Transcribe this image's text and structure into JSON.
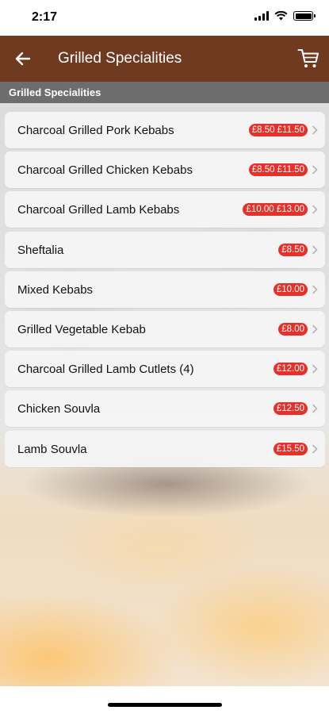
{
  "status": {
    "time": "2:17"
  },
  "header": {
    "title": "Grilled Specialities",
    "back_icon": "arrow-left-icon",
    "cart_icon": "cart-icon",
    "bg_color": "#6f3a20"
  },
  "section": {
    "label": "Grilled Specialities"
  },
  "items": [
    {
      "name": "Charcoal Grilled Pork Kebabs",
      "price": "£8.50 £11.50"
    },
    {
      "name": "Charcoal Grilled Chicken Kebabs",
      "price": "£8.50 £11.50"
    },
    {
      "name": "Charcoal Grilled Lamb Kebabs",
      "price": "£10.00 £13.00"
    },
    {
      "name": "Sheftalia",
      "price": "£8.50"
    },
    {
      "name": "Mixed Kebabs",
      "price": "£10.00"
    },
    {
      "name": "Grilled Vegetable Kebab",
      "price": "£8.00"
    },
    {
      "name": "Charcoal Grilled Lamb Cutlets (4)",
      "price": "£12.00"
    },
    {
      "name": "Chicken Souvla",
      "price": "£12.50"
    },
    {
      "name": "Lamb Souvla",
      "price": "£15.50"
    }
  ],
  "colors": {
    "price_badge": "#e8302a",
    "section_bar": "#6d6d6d"
  }
}
